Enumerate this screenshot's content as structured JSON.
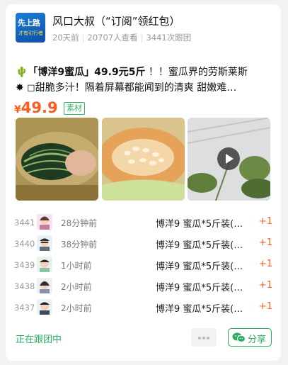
{
  "header": {
    "avatar_logo_text_1": "先上路",
    "avatar_logo_text_2": "才有引行者",
    "title": "风口大叔（“订阅”领红包）",
    "time_ago": "20天前",
    "views": "20707人查看",
    "followers": "3441次跟团"
  },
  "post": {
    "line1_emoji": "🌵",
    "line1_title": "「博洋9蜜瓜」49.9元5斤",
    "line1_rest": " ！！蜜瓜界的劳斯莱斯",
    "line2_emoji": "✸",
    "line2_text": " ◻甜脆多汁！隔着屏幕都能闻到的清爽 甜嫩难…",
    "price_symbol": "¥",
    "price_value": "49.9",
    "tag": "素材"
  },
  "orders": [
    {
      "seq": "3441",
      "time": "28分钟前",
      "product": "博洋9 蜜瓜*5斤装(…",
      "count": "+1"
    },
    {
      "seq": "3440",
      "time": "38分钟前",
      "product": "博洋9 蜜瓜*5斤装(…",
      "count": "+1"
    },
    {
      "seq": "3439",
      "time": "1小时前",
      "product": "博洋9 蜜瓜*5斤装(…",
      "count": "+1"
    },
    {
      "seq": "3438",
      "time": "2小时前",
      "product": "博洋9 蜜瓜*5斤装(…",
      "count": "+1"
    },
    {
      "seq": "3437",
      "time": "2小时前",
      "product": "博洋9 蜜瓜*5斤装(…",
      "count": "+1"
    }
  ],
  "footer": {
    "status": "正在跟团中",
    "share_label": "分享"
  },
  "colors": {
    "accent_green": "#27ae60",
    "price_orange": "#ff5a1f"
  }
}
